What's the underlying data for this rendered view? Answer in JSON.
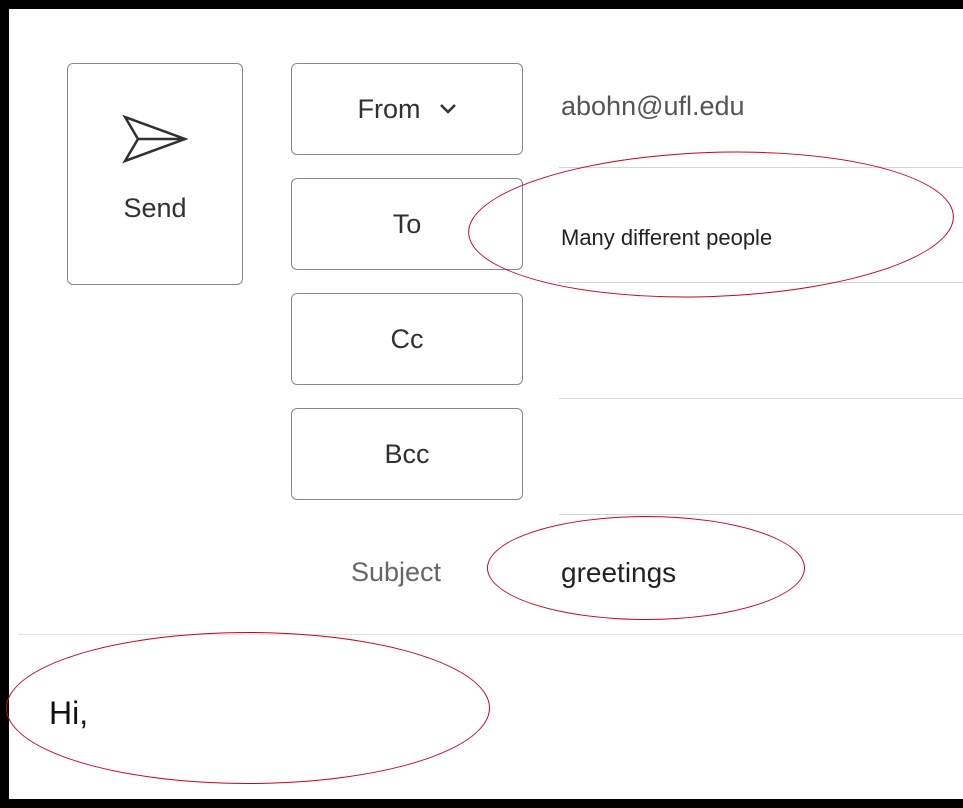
{
  "compose": {
    "send_label": "Send",
    "from_label": "From",
    "from_value": "abohn@ufl.edu",
    "to_label": "To",
    "to_value": "Many different people",
    "cc_label": "Cc",
    "bcc_label": "Bcc",
    "subject_label": "Subject",
    "subject_value": "greetings",
    "body_text": "Hi,"
  },
  "icons": {
    "send": "send-arrow-icon",
    "from_dropdown": "chevron-down-icon"
  },
  "colors": {
    "annotation": "#d0021b",
    "frame": "#000000",
    "button_border": "#8a8886"
  }
}
